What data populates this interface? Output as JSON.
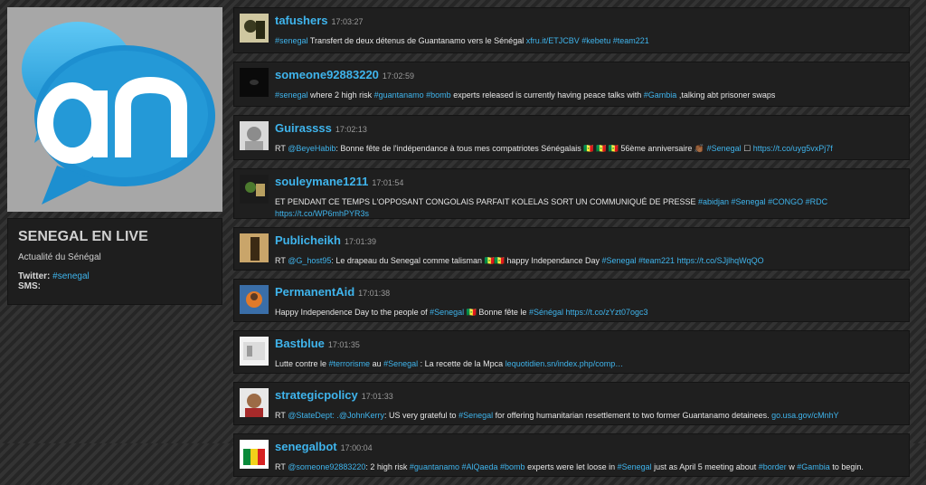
{
  "profile": {
    "title": "SENEGAL EN LIVE",
    "subtitle": "Actualité du Sénégal",
    "twitter_label": "Twitter: ",
    "twitter_value": "#senegal",
    "sms_label": "SMS:"
  },
  "tweets": [
    {
      "user": "tafushers",
      "time": "17:03:27",
      "parts": [
        {
          "t": "#senegal",
          "h": 1
        },
        {
          "t": " Transfert de deux détenus de Guantanamo vers le Sénégal "
        },
        {
          "t": "xfru.it/ETJCBV",
          "h": 1
        },
        {
          "t": " "
        },
        {
          "t": "#kebetu",
          "h": 1
        },
        {
          "t": " "
        },
        {
          "t": "#team221",
          "h": 1
        }
      ]
    },
    {
      "user": "someone92883220",
      "time": "17:02:59",
      "parts": [
        {
          "t": "#senegal",
          "h": 1
        },
        {
          "t": " where 2 high risk "
        },
        {
          "t": "#guantanamo",
          "h": 1
        },
        {
          "t": " "
        },
        {
          "t": "#bomb",
          "h": 1
        },
        {
          "t": " experts released is currently having peace talks with "
        },
        {
          "t": "#Gambia",
          "h": 1
        },
        {
          "t": " ,talking abt prisoner swaps"
        }
      ]
    },
    {
      "user": "Guirassss",
      "time": "17:02:13",
      "parts": [
        {
          "t": "RT "
        },
        {
          "t": "@BeyeHabib",
          "h": 1
        },
        {
          "t": ": Bonne fête de l'indépendance à tous mes compatriotes Sénégalais 🇸🇳 🇸🇳 🇸🇳          56ème anniversaire 👏🏾 "
        },
        {
          "t": "#Senegal",
          "h": 1
        },
        {
          "t": " ☐ "
        },
        {
          "t": "https://t.co/uyg5vxPj7f",
          "h": 1
        }
      ]
    },
    {
      "user": "souleymane1211",
      "time": "17:01:54",
      "wrap": true,
      "parts": [
        {
          "t": "ET PENDANT CE TEMPS L'OPPOSANT CONGOLAIS PARFAIT KOLELAS SORT UN COMMUNIQUÉ DE PRESSE "
        },
        {
          "t": "#abidjan",
          "h": 1
        },
        {
          "t": " "
        },
        {
          "t": "#Senegal",
          "h": 1
        },
        {
          "t": " "
        },
        {
          "t": "#CONGO",
          "h": 1
        },
        {
          "t": " "
        },
        {
          "t": "#RDC",
          "h": 1
        },
        {
          "t": " "
        },
        {
          "t": "https://t.co/WP6mhPYR3s",
          "h": 1
        }
      ]
    },
    {
      "user": "Publicheikh",
      "time": "17:01:39",
      "parts": [
        {
          "t": "RT "
        },
        {
          "t": "@G_host95",
          "h": 1
        },
        {
          "t": ": Le drapeau du Senegal comme talisman 🇸🇳🇸🇳 happy Independance Day "
        },
        {
          "t": "#Senegal",
          "h": 1
        },
        {
          "t": " "
        },
        {
          "t": "#team221",
          "h": 1
        },
        {
          "t": " "
        },
        {
          "t": "https://t.co/SJjlhqWqQO",
          "h": 1
        }
      ]
    },
    {
      "user": "PermanentAid",
      "time": "17:01:38",
      "parts": [
        {
          "t": "Happy Independence Day to the people of "
        },
        {
          "t": "#Senegal",
          "h": 1
        },
        {
          "t": " 🇸🇳      Bonne fête le "
        },
        {
          "t": "#Sénégal",
          "h": 1
        },
        {
          "t": " "
        },
        {
          "t": "https://t.co/zYzt07ogc3",
          "h": 1
        }
      ]
    },
    {
      "user": "Bastblue",
      "time": "17:01:35",
      "parts": [
        {
          "t": "Lutte contre le "
        },
        {
          "t": "#terrorisme",
          "h": 1
        },
        {
          "t": " au "
        },
        {
          "t": "#Senegal",
          "h": 1
        },
        {
          "t": " : La recette de la Mpca "
        },
        {
          "t": "lequotidien.sn/index.php/comp…",
          "h": 1
        }
      ]
    },
    {
      "user": "strategicpolicy",
      "time": "17:01:33",
      "parts": [
        {
          "t": "RT "
        },
        {
          "t": "@StateDept",
          "h": 1
        },
        {
          "t": ": .@JohnKerry",
          "h": 1
        },
        {
          "t": ": US very grateful to "
        },
        {
          "t": "#Senegal",
          "h": 1
        },
        {
          "t": " for offering humanitarian resettlement to two former Guantanamo detainees. "
        },
        {
          "t": "go.usa.gov/cMnhY",
          "h": 1
        }
      ]
    },
    {
      "user": "senegalbot",
      "time": "17:00:04",
      "parts": [
        {
          "t": "RT "
        },
        {
          "t": "@someone92883220",
          "h": 1
        },
        {
          "t": ": 2 high risk "
        },
        {
          "t": "#guantanamo",
          "h": 1
        },
        {
          "t": " "
        },
        {
          "t": "#AlQaeda",
          "h": 1
        },
        {
          "t": " "
        },
        {
          "t": "#bomb",
          "h": 1
        },
        {
          "t": " experts were let loose in "
        },
        {
          "t": "#Senegal",
          "h": 1
        },
        {
          "t": " just as April 5 meeting about "
        },
        {
          "t": "#border",
          "h": 1
        },
        {
          "t": " w "
        },
        {
          "t": "#Gambia",
          "h": 1
        },
        {
          "t": " to begin."
        }
      ]
    }
  ]
}
